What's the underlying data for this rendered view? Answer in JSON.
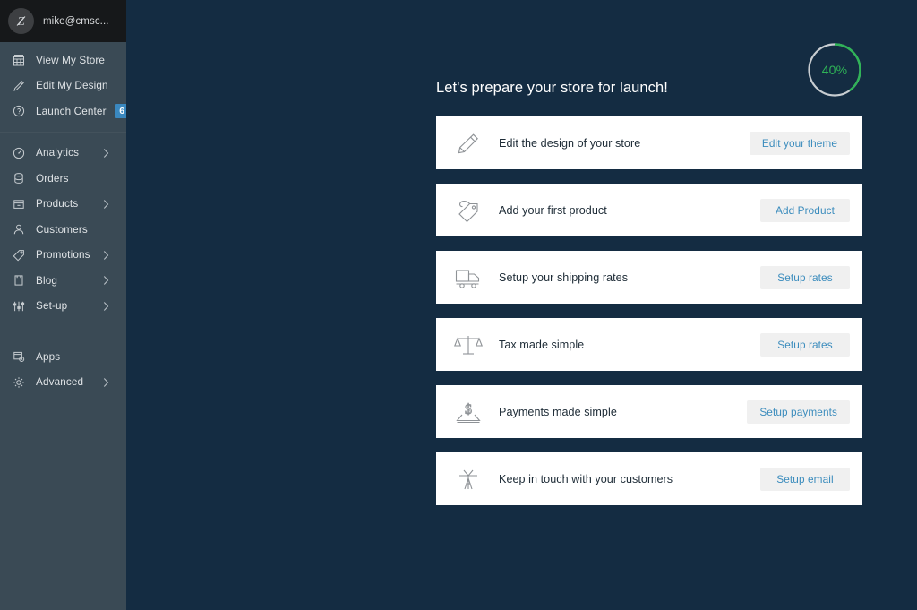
{
  "account": {
    "logo_icon": "z-logo-icon",
    "name": "mike@cmsc..."
  },
  "sidebar": {
    "primary_items": [
      {
        "label": "View My Store",
        "icon": "store-icon",
        "chevron": false,
        "badge": null
      },
      {
        "label": "Edit My Design",
        "icon": "pencil-icon",
        "chevron": false,
        "badge": null
      },
      {
        "label": "Launch Center",
        "icon": "help-circle-icon",
        "chevron": false,
        "badge": "6"
      }
    ],
    "secondary_items": [
      {
        "label": "Analytics",
        "icon": "speedometer-icon",
        "chevron": true,
        "badge": null
      },
      {
        "label": "Orders",
        "icon": "database-icon",
        "chevron": false,
        "badge": null
      },
      {
        "label": "Products",
        "icon": "box-icon",
        "chevron": true,
        "badge": null
      },
      {
        "label": "Customers",
        "icon": "user-icon",
        "chevron": false,
        "badge": null
      },
      {
        "label": "Promotions",
        "icon": "tag-icon",
        "chevron": true,
        "badge": null
      },
      {
        "label": "Blog",
        "icon": "notebook-icon",
        "chevron": true,
        "badge": null
      },
      {
        "label": "Set-up",
        "icon": "sliders-icon",
        "chevron": true,
        "badge": null
      }
    ],
    "tertiary_items": [
      {
        "label": "Apps",
        "icon": "apps-icon",
        "chevron": false,
        "badge": null
      },
      {
        "label": "Advanced",
        "icon": "gear-icon",
        "chevron": true,
        "badge": null
      }
    ]
  },
  "main": {
    "title": "Let's prepare your store for launch!",
    "progress": {
      "percent": 40,
      "label": "40%",
      "ring_color": "#2fb457",
      "track_color": "#c8cdd1"
    },
    "tasks": [
      {
        "title": "Edit the design of your store",
        "icon": "pencil-icon",
        "button": "Edit your theme"
      },
      {
        "title": "Add your first product",
        "icon": "tag-icon",
        "button": "Add Product"
      },
      {
        "title": "Setup your shipping rates",
        "icon": "truck-icon",
        "button": "Setup rates"
      },
      {
        "title": "Tax made simple",
        "icon": "scales-icon",
        "button": "Setup rates"
      },
      {
        "title": "Payments made simple",
        "icon": "payment-icon",
        "button": "Setup payments"
      },
      {
        "title": "Keep in touch with your customers",
        "icon": "antenna-icon",
        "button": "Setup email"
      }
    ]
  },
  "colors": {
    "background": "#142c42",
    "sidebar": "#3a4a55",
    "account_bar": "#16181a",
    "card": "#ffffff",
    "button_bg": "#f0f0f0",
    "button_text": "#3b8cbd",
    "badge": "#3a88bf",
    "accent_green": "#2fb457"
  }
}
